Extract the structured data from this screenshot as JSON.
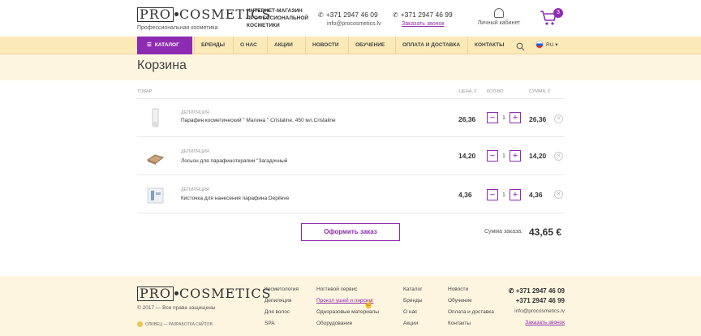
{
  "header": {
    "logo_left": "PRO",
    "logo_right": "COSMETICS",
    "logo_sub": "Профессиональная косметика",
    "description_lines": [
      "ИНТЕРНЕТ-МАГАЗИН",
      "ПРОФЕССИОНАЛЬНОЙ",
      "КОСМЕТИКИ"
    ],
    "phone1": "+371 2947 46 09",
    "email": "info@procosmetics.lv",
    "phone2": "+371 2947 46 99",
    "callback": "Заказать звонок",
    "cabinet": "Личный кабинет",
    "cart_count": "3"
  },
  "nav": {
    "catalog": "Каталог",
    "items": [
      "Бренды",
      "О нас",
      "Акции",
      "Новости",
      "Обучение",
      "Оплата и доставка",
      "Контакты"
    ],
    "lang": "RU"
  },
  "page": {
    "title": "Корзина"
  },
  "table": {
    "headers": {
      "product": "Товар",
      "price": "Цена, €",
      "qty": "Кол-во",
      "sum": "Сумма, €"
    },
    "rows": [
      {
        "category": "Депиляция",
        "name": "Парафин косметический \" Малина \" Cristaline, 450 мл.Cristaline",
        "price": "26,36",
        "qty": "1",
        "sum": "26,36"
      },
      {
        "category": "Депиляция",
        "name": "Лосьон для парафинотерапии \"Загадочный",
        "price": "14,20",
        "qty": "1",
        "sum": "14,20"
      },
      {
        "category": "Депиляция",
        "name": "Кисточка для нанесения парафина Depileve",
        "price": "4,36",
        "qty": "1",
        "sum": "4,36"
      }
    ]
  },
  "order": {
    "button": "Оформить заказ",
    "total_label": "Сумма заказа:",
    "total": "43,65 €"
  },
  "footer": {
    "copyright": "© 2017 — Все права защищены",
    "developer": "ОЛИВЕЦ — РАЗРАБОТКА САЙТОВ",
    "col1": [
      "Косметология",
      "Депиляция",
      "Для волос",
      "SPA"
    ],
    "col2": [
      "Ногтевой сервис",
      "Прокол ушей и пирсинг",
      "Одноразовые материалы",
      "Оборудование"
    ],
    "col3": [
      "Каталог",
      "Бренды",
      "О нас",
      "Акции"
    ],
    "col4": [
      "Новости",
      "Обучение",
      "Оплата и доставка",
      "Контакты"
    ],
    "phone1": "+371 2947 46 09",
    "phone2": "+371 2947 46 99",
    "email": "info@procosmetics.lv",
    "callback": "Заказать звонок"
  },
  "colors": {
    "accent": "#8e2bb3",
    "nav_bg": "#fbe9b8",
    "band_bg": "#fdf5e0"
  }
}
